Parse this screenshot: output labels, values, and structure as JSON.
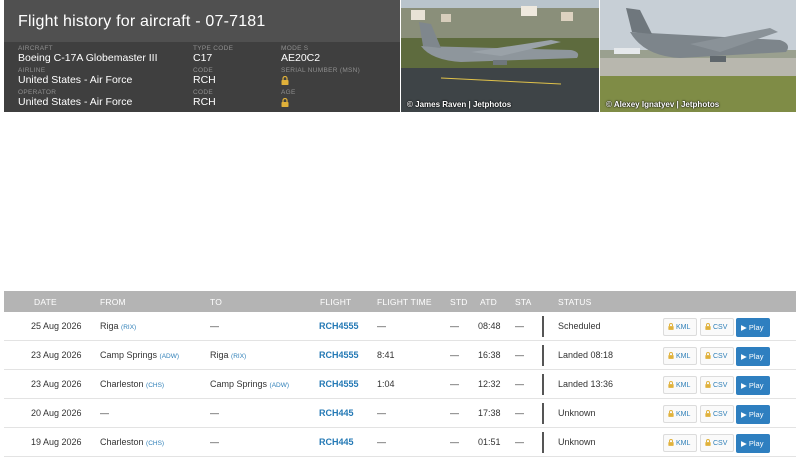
{
  "header": {
    "title": "Flight history for aircraft - 07-7181",
    "aircraft": {
      "label": "AIRCRAFT",
      "value": "Boeing C-17A Globemaster III"
    },
    "type_code": {
      "label": "TYPE CODE",
      "value": "C17"
    },
    "mode_s": {
      "label": "MODE S",
      "value": "AE20C2"
    },
    "airline": {
      "label": "AIRLINE",
      "value": "United States - Air Force"
    },
    "airline_code": {
      "label": "Code",
      "value": "RCH"
    },
    "serial_number": {
      "label": "SERIAL NUMBER (MSN)"
    },
    "operator": {
      "label": "OPERATOR",
      "value": "United States - Air Force"
    },
    "operator_code": {
      "label": "Code",
      "value": "RCH"
    },
    "age": {
      "label": "AGE"
    }
  },
  "photos": [
    {
      "credit": "© James Raven | Jetphotos"
    },
    {
      "credit": "© Alexey Ignatyev | Jetphotos"
    }
  ],
  "table": {
    "columns": [
      "DATE",
      "FROM",
      "TO",
      "FLIGHT",
      "FLIGHT TIME",
      "STD",
      "ATD",
      "STA",
      "STATUS"
    ],
    "kml_label": "KML",
    "csv_label": "CSV",
    "play_label": "▶ Play",
    "rows": [
      {
        "date": "25 Aug 2026",
        "from": "Riga",
        "from_code": "(RIX)",
        "to": "—",
        "to_code": "",
        "flight": "RCH4555",
        "flight_time": "—",
        "std": "—",
        "atd": "08:48",
        "sta": "—",
        "status": "Scheduled"
      },
      {
        "date": "23 Aug 2026",
        "from": "Camp Springs",
        "from_code": "(ADW)",
        "to": "Riga",
        "to_code": "(RIX)",
        "flight": "RCH4555",
        "flight_time": "8:41",
        "std": "—",
        "atd": "16:38",
        "sta": "—",
        "status": "Landed 08:18"
      },
      {
        "date": "23 Aug 2026",
        "from": "Charleston",
        "from_code": "(CHS)",
        "to": "Camp Springs",
        "to_code": "(ADW)",
        "flight": "RCH4555",
        "flight_time": "1:04",
        "std": "—",
        "atd": "12:32",
        "sta": "—",
        "status": "Landed 13:36"
      },
      {
        "date": "20 Aug 2026",
        "from": "—",
        "from_code": "",
        "to": "—",
        "to_code": "",
        "flight": "RCH445",
        "flight_time": "—",
        "std": "—",
        "atd": "17:38",
        "sta": "—",
        "status": "Unknown"
      },
      {
        "date": "19 Aug 2026",
        "from": "Charleston",
        "from_code": "(CHS)",
        "to": "—",
        "to_code": "",
        "flight": "RCH445",
        "flight_time": "—",
        "std": "—",
        "atd": "01:51",
        "sta": "—",
        "status": "Unknown"
      }
    ]
  },
  "colors": {
    "header_bg": "#3f3f3f",
    "table_header_bg": "#b4b4b4",
    "link": "#2479b5",
    "play_button": "#2e7fc0",
    "lock": "#e0b13a"
  }
}
